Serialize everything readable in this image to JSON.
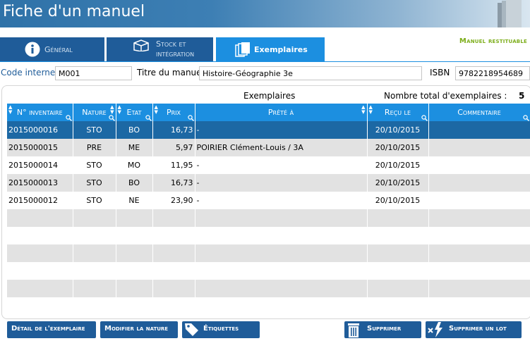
{
  "window": {
    "title": "Fiche d'un manuel",
    "books_icon": "books-icon"
  },
  "status": {
    "restituable": "Manuel restituable",
    "color": "#7dae1b"
  },
  "tabs": [
    {
      "label": "Général",
      "icon": "info-icon",
      "active": false
    },
    {
      "label": "Stock et intégration",
      "icon": "box-icon",
      "active": false
    },
    {
      "label": "Exemplaires",
      "icon": "copies-icon",
      "active": true
    }
  ],
  "form": {
    "code_label": "Code interne",
    "code_value": "M001",
    "titre_label": "Titre du manuel",
    "titre_value": "Histoire-Géographie 3e",
    "isbn_label": "ISBN",
    "isbn_value": "9782218954689"
  },
  "exemplaires": {
    "section_title": "Exemplaires",
    "total_label": "Nombre total d'exemplaires :",
    "total_value": "5",
    "columns": [
      "N° inventaire",
      "Nature",
      "Etat",
      "Prix",
      "Prêté à",
      "Reçu le",
      "Commentaire"
    ],
    "rows": [
      {
        "inventaire": "2015000016",
        "nature": "STO",
        "etat": "BO",
        "prix": "16,73",
        "prete": "-",
        "recu": "20/10/2015",
        "commentaire": ""
      },
      {
        "inventaire": "2015000015",
        "nature": "PRE",
        "etat": "ME",
        "prix": "5,97",
        "prete": "POIRIER Clément-Louis / 3A",
        "recu": "20/10/2015",
        "commentaire": ""
      },
      {
        "inventaire": "2015000014",
        "nature": "STO",
        "etat": "MO",
        "prix": "11,95",
        "prete": "-",
        "recu": "20/10/2015",
        "commentaire": ""
      },
      {
        "inventaire": "2015000013",
        "nature": "STO",
        "etat": "BO",
        "prix": "16,73",
        "prete": "-",
        "recu": "20/10/2015",
        "commentaire": ""
      },
      {
        "inventaire": "2015000012",
        "nature": "STO",
        "etat": "NE",
        "prix": "23,90",
        "prete": "-",
        "recu": "20/10/2015",
        "commentaire": ""
      }
    ],
    "selected_index": 0
  },
  "buttons": {
    "detail": "Détail de l'exemplaire",
    "modifier": "Modifier la nature",
    "etiquettes": "Étiquettes",
    "supprimer": "Supprimer",
    "supprimer_lot": "Supprimer un lot"
  },
  "colors": {
    "header_blue": "#1c8fe0",
    "dark_blue": "#1f5c99",
    "selected_row": "#1c68a4"
  }
}
